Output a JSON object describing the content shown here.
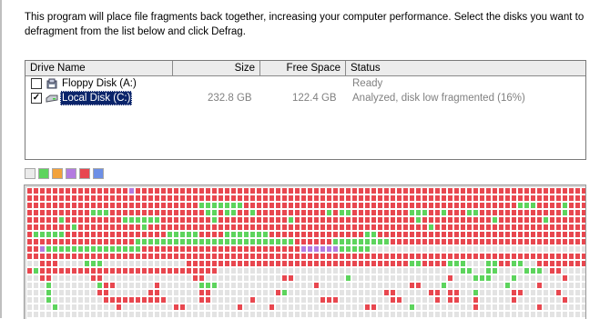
{
  "description": "This program will place file fragments back together, increasing your computer performance. Select the disks you want to defragment from the list below and click Defrag.",
  "columns": [
    "Drive Name",
    "Size",
    "Free Space",
    "Status"
  ],
  "drives": [
    {
      "checked": false,
      "icon": "floppy-drive-icon",
      "name": "Floppy Disk (A:)",
      "size": "",
      "free": "",
      "status": "Ready"
    },
    {
      "checked": true,
      "icon": "hard-drive-icon",
      "name": "Local Disk (C:)",
      "size": "232.8 GB",
      "free": "122.4 GB",
      "status": "Analyzed, disk low fragmented (16%)"
    }
  ],
  "legend_colors": [
    "#ebebeb",
    "#5dd45d",
    "#f2a23c",
    "#b37be0",
    "#e8474f",
    "#6d8fe6"
  ],
  "block_colors": {
    "r": "#e8474f",
    "g": "#5dd45d",
    "e": "#e3e3e3",
    "p": "#b37be0"
  },
  "map_rows": [
    "rrrrrrrrrrrrrrrrrrrrrrrrrrrrrrrrrrrrrrrrrrrrrrrrrrrrrrrrrrrrrrrrrrrrrrrrrrrrrrrrrrrrrrrr",
    "rrrrrrrrrrrrrrrrrrrrrrrrrrrrrrrrrrrrrrrrrrrrrrrrrrrrrrrrrrrrrrrrrrrrrrrrrrrrrrrrrrrrrrrr",
    "rrrrrrrrrrrrrrrrrrrrrrrrrrrgggggggrrrrrrrrrrrrrrrrrrrrrrrrrrrrrrrrrrrrrrrrrrrgggrrrrgrrr",
    "rrrrrrrrrrgggrrrrrrrrrrrrrrrggrggrrgrrrrrrrrrrrgrggrrrrrrrrrgggrrgrrrggrrrrrrrrrrrrrgrrr",
    "rrrrrgrrrrrrrrrggggggrrrrrrrrgrrrrrrrrrrrgrrrrrrrrrrrrrrrrrrrgrrrrrrrrrrrgrrrrrrrgrrrrrr",
    "rrrrrrrgrrrrrrrrrrgrrrrrrrrrrrrrrrrrrrrrrrrrrrrrrrrrrrrrrrrrrrrgrrrrrrrrrrrrrrrrrrrrrrrr",
    "rgggggrrrrrrrrrrrrrrrrgggggrrrrgggggggrrrrrrrrrrrrrrrggrrrrrrrrrrrrrrrrrrrrrrrrrrrrrrrrr",
    "rrrrrrrrrrrrrrrrrgggggggggggggggggggggggggrrrrrrgggggggggrrrrrrrrrrrrrrrrrrrrrrrrrrrrrrrrr",
    "rrpgggggggggggggggrrrrrrrrrrrrrrrrrrrrrrrrrppppppgggggeeeeeeeeeeeeeeeeeeeeeeeeeeeeeeeeeeee",
    "rrrrrrrrrrrrrrrrrrrrrrrrrrrrrrrrrrrrrrrrrrrrrrrrrrrrrrrrrrrrrrrrrrrrrrrrrrrrrrrrrrrrrrrr",
    "eereeeeeeeeeeeeeeeeeeeeeerrrrrrrrrrrrrrrrrrrrrrrrrrrrrrrrrrrreeeeeeeeeeegggeeeeeeeeeeeee",
    "eerrrrrrrrrrrrrrrrrrrrrrrrrrrrrrrrrrrrrrrrrrrrrrrrrrrrrrrrrrrrrrrrrrrrrrrrrrrrrrrrrrrrrr",
    "eereeeeeeeeeeeeeeeeeeeeeeeeeeeeeeeeeeeeeeeeeeeeeeeeeeeeeeeeeeeeeeeeeeeeeeeeeeeeeeeeeeeee",
    "eeegeeeeeeegeeeeeeeeeeeeeeegggeeeeeeeeeeeeeeeeeeeeeeeeeeeeeeeeeeeeeeeeeeeeeeeeeeeeeeeeee",
    "eeeeeeeeeeeeeeeeeeeeeeeeeeeeeeeeeeeeeeeeeeeeeeeeeeeeeeeeeeeeeeeeeeeeeeeeeeeeeeeeeeeeeeee",
    "eeeeeeeeeeeeeeeeeeeeeeeeeeeeeeeeeeeeeeeeeeeeeeeeeeeeeeeeeeeeeeeeeeeeeeeeeeeeeeeeeeeeeeee",
    "eeeeeeeeeeeeeeeeeeeeeeeeeeeeeeeeeeeeeeeeeeeeeeeeeeeeeeeeeeeeeeeeeeeeeeeeeeeeeeeeeeeeeeee",
    "eeeeeeeeeeeeeeeeeeeeeeeeeeeeeeeeeeeeeeeeeeeeeeeeeeeeeeeeeeeeeeeeeeeeeeeeeeeeeeeeeeeeeeee",
    "eeeeeeeeeeeeeeeeeeeeeeeeeeeeeeeeeeeeeeeeeeeeeeeeeeeeeeeeeeeeeeeeeeeeeeeeeeeeeeeeeeeeeeee"
  ],
  "map_overrides": [
    [
      0,
      16,
      "p"
    ],
    [
      8,
      2,
      "p"
    ],
    [
      10,
      3,
      "r"
    ],
    [
      10,
      4,
      "r"
    ],
    [
      10,
      9,
      "g"
    ],
    [
      10,
      10,
      "g"
    ],
    [
      10,
      11,
      "g"
    ],
    [
      10,
      60,
      "g"
    ],
    [
      10,
      61,
      "g"
    ],
    [
      10,
      62,
      "r"
    ],
    [
      10,
      63,
      "r"
    ],
    [
      10,
      64,
      "r"
    ],
    [
      10,
      65,
      "r"
    ],
    [
      10,
      66,
      "g"
    ],
    [
      10,
      67,
      "g"
    ],
    [
      10,
      68,
      "g"
    ],
    [
      10,
      74,
      "r"
    ],
    [
      10,
      75,
      "r"
    ],
    [
      10,
      76,
      "g"
    ],
    [
      10,
      77,
      "g"
    ],
    [
      10,
      80,
      "r"
    ],
    [
      10,
      81,
      "r"
    ],
    [
      10,
      82,
      "r"
    ],
    [
      10,
      83,
      "r"
    ],
    [
      10,
      84,
      "r"
    ],
    [
      10,
      85,
      "r"
    ],
    [
      10,
      86,
      "r"
    ],
    [
      10,
      87,
      "r"
    ],
    [
      11,
      0,
      "r"
    ],
    [
      11,
      1,
      "g"
    ],
    [
      11,
      30,
      "e"
    ],
    [
      11,
      31,
      "e"
    ],
    [
      11,
      32,
      "e"
    ],
    [
      11,
      33,
      "e"
    ],
    [
      11,
      34,
      "e"
    ],
    [
      11,
      35,
      "e"
    ],
    [
      11,
      36,
      "e"
    ],
    [
      11,
      37,
      "e"
    ],
    [
      11,
      38,
      "e"
    ],
    [
      11,
      39,
      "e"
    ],
    [
      11,
      40,
      "e"
    ],
    [
      11,
      41,
      "e"
    ],
    [
      11,
      42,
      "e"
    ],
    [
      11,
      43,
      "e"
    ],
    [
      11,
      44,
      "e"
    ],
    [
      11,
      45,
      "e"
    ],
    [
      11,
      46,
      "e"
    ],
    [
      11,
      47,
      "e"
    ],
    [
      11,
      48,
      "e"
    ],
    [
      11,
      49,
      "e"
    ],
    [
      11,
      50,
      "e"
    ],
    [
      11,
      51,
      "e"
    ],
    [
      11,
      52,
      "e"
    ],
    [
      11,
      53,
      "e"
    ],
    [
      11,
      54,
      "e"
    ],
    [
      11,
      55,
      "e"
    ],
    [
      11,
      56,
      "e"
    ],
    [
      11,
      57,
      "e"
    ],
    [
      11,
      58,
      "e"
    ],
    [
      11,
      59,
      "e"
    ],
    [
      11,
      60,
      "e"
    ],
    [
      11,
      61,
      "e"
    ],
    [
      11,
      62,
      "e"
    ],
    [
      11,
      63,
      "e"
    ],
    [
      11,
      64,
      "e"
    ],
    [
      11,
      65,
      "e"
    ],
    [
      11,
      66,
      "e"
    ],
    [
      11,
      67,
      "e"
    ],
    [
      11,
      68,
      "g"
    ],
    [
      11,
      69,
      "g"
    ],
    [
      11,
      70,
      "e"
    ],
    [
      11,
      71,
      "e"
    ],
    [
      11,
      72,
      "g"
    ],
    [
      11,
      73,
      "g"
    ],
    [
      11,
      74,
      "e"
    ],
    [
      11,
      75,
      "e"
    ],
    [
      11,
      76,
      "e"
    ],
    [
      11,
      77,
      "e"
    ],
    [
      11,
      78,
      "g"
    ],
    [
      11,
      79,
      "g"
    ],
    [
      11,
      80,
      "g"
    ],
    [
      11,
      81,
      "e"
    ],
    [
      11,
      82,
      "r"
    ],
    [
      11,
      83,
      "r"
    ],
    [
      11,
      84,
      "e"
    ],
    [
      11,
      85,
      "e"
    ],
    [
      11,
      86,
      "e"
    ],
    [
      11,
      87,
      "e"
    ],
    [
      12,
      2,
      "r"
    ],
    [
      12,
      3,
      "r"
    ],
    [
      12,
      10,
      "r"
    ],
    [
      12,
      11,
      "r"
    ],
    [
      12,
      26,
      "r"
    ],
    [
      12,
      27,
      "r"
    ],
    [
      12,
      40,
      "r"
    ],
    [
      12,
      41,
      "r"
    ],
    [
      12,
      50,
      "g"
    ],
    [
      12,
      66,
      "r"
    ],
    [
      12,
      70,
      "g"
    ],
    [
      12,
      71,
      "g"
    ],
    [
      12,
      72,
      "g"
    ],
    [
      12,
      76,
      "g"
    ],
    [
      12,
      84,
      "r"
    ],
    [
      13,
      12,
      "r"
    ],
    [
      13,
      13,
      "r"
    ],
    [
      13,
      20,
      "r"
    ],
    [
      13,
      28,
      "g"
    ],
    [
      13,
      45,
      "r"
    ],
    [
      13,
      60,
      "r"
    ],
    [
      13,
      61,
      "r"
    ],
    [
      13,
      65,
      "g"
    ],
    [
      13,
      75,
      "g"
    ],
    [
      13,
      80,
      "r"
    ],
    [
      14,
      3,
      "g"
    ],
    [
      14,
      11,
      "r"
    ],
    [
      14,
      12,
      "r"
    ],
    [
      14,
      19,
      "r"
    ],
    [
      14,
      20,
      "r"
    ],
    [
      14,
      27,
      "r"
    ],
    [
      14,
      28,
      "r"
    ],
    [
      14,
      39,
      "r"
    ],
    [
      14,
      40,
      "g"
    ],
    [
      14,
      56,
      "r"
    ],
    [
      14,
      57,
      "r"
    ],
    [
      14,
      63,
      "r"
    ],
    [
      14,
      64,
      "r"
    ],
    [
      14,
      66,
      "r"
    ],
    [
      14,
      67,
      "r"
    ],
    [
      14,
      70,
      "g"
    ],
    [
      14,
      76,
      "r"
    ],
    [
      14,
      77,
      "r"
    ],
    [
      14,
      83,
      "r"
    ],
    [
      15,
      3,
      "g"
    ],
    [
      15,
      12,
      "r"
    ],
    [
      15,
      13,
      "r"
    ],
    [
      15,
      14,
      "r"
    ],
    [
      15,
      15,
      "r"
    ],
    [
      15,
      16,
      "r"
    ],
    [
      15,
      17,
      "r"
    ],
    [
      15,
      18,
      "r"
    ],
    [
      15,
      19,
      "r"
    ],
    [
      15,
      20,
      "r"
    ],
    [
      15,
      21,
      "r"
    ],
    [
      15,
      27,
      "r"
    ],
    [
      15,
      28,
      "r"
    ],
    [
      15,
      35,
      "r"
    ],
    [
      15,
      46,
      "r"
    ],
    [
      15,
      47,
      "r"
    ],
    [
      15,
      48,
      "r"
    ],
    [
      15,
      57,
      "r"
    ],
    [
      15,
      58,
      "r"
    ],
    [
      15,
      64,
      "r"
    ],
    [
      15,
      66,
      "r"
    ],
    [
      15,
      67,
      "r"
    ],
    [
      15,
      70,
      "r"
    ],
    [
      15,
      76,
      "r"
    ],
    [
      15,
      84,
      "r"
    ],
    [
      16,
      4,
      "g"
    ],
    [
      16,
      14,
      "r"
    ],
    [
      16,
      23,
      "r"
    ],
    [
      16,
      24,
      "r"
    ],
    [
      16,
      33,
      "r"
    ],
    [
      16,
      38,
      "r"
    ],
    [
      16,
      53,
      "r"
    ],
    [
      16,
      54,
      "r"
    ],
    [
      16,
      60,
      "g"
    ],
    [
      16,
      70,
      "r"
    ],
    [
      16,
      80,
      "r"
    ]
  ]
}
